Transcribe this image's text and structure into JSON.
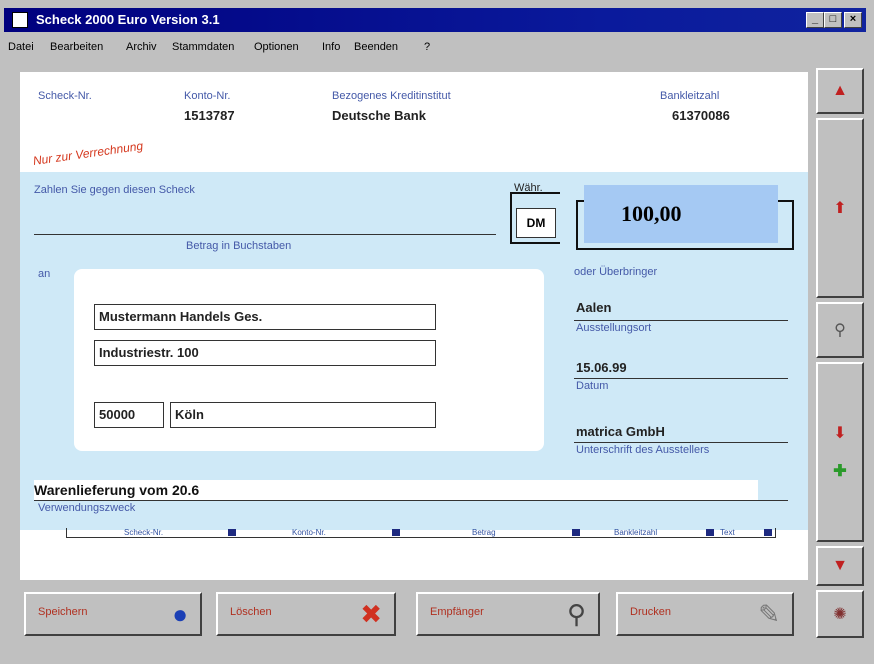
{
  "window": {
    "title": "Scheck 2000 Euro Version 3.1",
    "buttons": [
      "_",
      "□",
      "×"
    ]
  },
  "menu": [
    "Datei",
    "Bearbeiten",
    "Archiv",
    "Stammdaten",
    "Optionen",
    "Info",
    "Beenden",
    "?"
  ],
  "header": {
    "scheck_nr_label": "Scheck-Nr.",
    "konto_label": "Konto-Nr.",
    "konto_value": "1513787",
    "institut_label": "Bezogenes Kreditinstitut",
    "institut_value": "Deutsche Bank",
    "blz_label": "Bankleitzahl",
    "blz_value": "61370086"
  },
  "stamp": "Nur zur Verrechnung",
  "body": {
    "pay_text": "Zahlen Sie gegen diesen Scheck",
    "words_label": "Betrag in Buchstaben",
    "waehrung_label": "Währ.",
    "currency": "DM",
    "amount": "100,00",
    "an_label": "an",
    "oder_label": "oder Überbringer"
  },
  "recipient": {
    "name": "Mustermann Handels Ges.",
    "street": "Industriestr. 100",
    "plz": "50000",
    "city": "Köln"
  },
  "issue": {
    "place_value": "Aalen",
    "place_label": "Ausstellungsort",
    "date_value": "15.06.99",
    "date_label": "Datum",
    "signer_value": "matrica GmbH",
    "signer_label": "Unterschrift des Ausstellers"
  },
  "purpose": {
    "value": "Warenlieferung vom 20.6",
    "label": "Verwendungszweck"
  },
  "codeline": [
    "Scheck-Nr.",
    "Konto-Nr.",
    "Betrag",
    "Bankleitzahl",
    "Text"
  ],
  "bottom_buttons": [
    {
      "label": "Speichern",
      "icon": "save-icon"
    },
    {
      "label": "Löschen",
      "icon": "delete-icon"
    },
    {
      "label": "Empfänger",
      "icon": "magnifier-icon"
    },
    {
      "label": "Drucken",
      "icon": "print-icon"
    }
  ],
  "side_buttons": [
    "scroll-top-icon",
    "up-arrow-icon",
    "magnifier-icon",
    "down-arrow-icon",
    "add-icon",
    "scroll-bottom-icon",
    "exit-icon"
  ],
  "colors": {
    "title_bar": "#00007e",
    "cheque_blue": "#cfe9f7",
    "amount_box": "#a5c9f3",
    "stamp_red": "#d5391f",
    "label_blue": "#4459a8"
  }
}
